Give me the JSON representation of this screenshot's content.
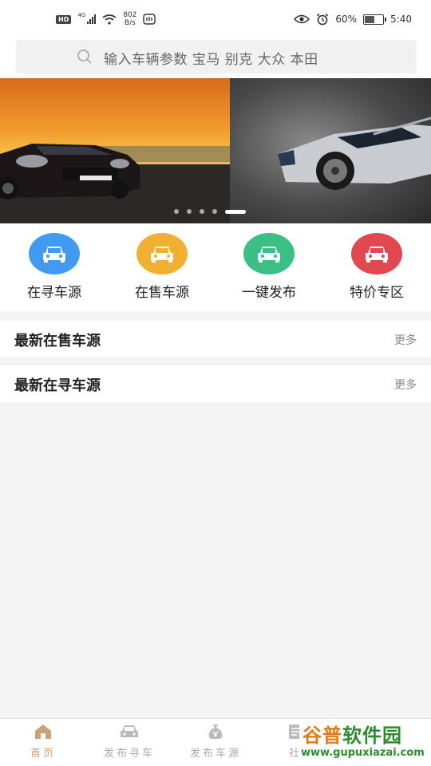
{
  "status_bar": {
    "hd": "HD",
    "network": "4G",
    "speed_value": "802",
    "speed_unit": "B/s",
    "battery": "60%",
    "battery_level": 0.6,
    "time": "5:40"
  },
  "search": {
    "placeholder": "输入车辆参数 宝马 别克 大众 本田"
  },
  "banner": {
    "slide_count": 5,
    "active_index": 4
  },
  "quick_menu": [
    {
      "label": "在寻车源",
      "color": "#3f9af0"
    },
    {
      "label": "在售车源",
      "color": "#f2b033"
    },
    {
      "label": "一键发布",
      "color": "#3cbf85"
    },
    {
      "label": "特价专区",
      "color": "#e2484f"
    }
  ],
  "sections": [
    {
      "title": "最新在售车源",
      "more": "更多"
    },
    {
      "title": "最新在寻车源",
      "more": "更多"
    }
  ],
  "tab_bar": {
    "active_color": "#c9a27a",
    "items": [
      {
        "label": "首页"
      },
      {
        "label": "发布寻车"
      },
      {
        "label": "发布车源"
      },
      {
        "label": "社"
      }
    ]
  },
  "watermark": {
    "brand_a": "谷普",
    "brand_b": "软件园",
    "url": "www.gupuxiazai.com"
  }
}
